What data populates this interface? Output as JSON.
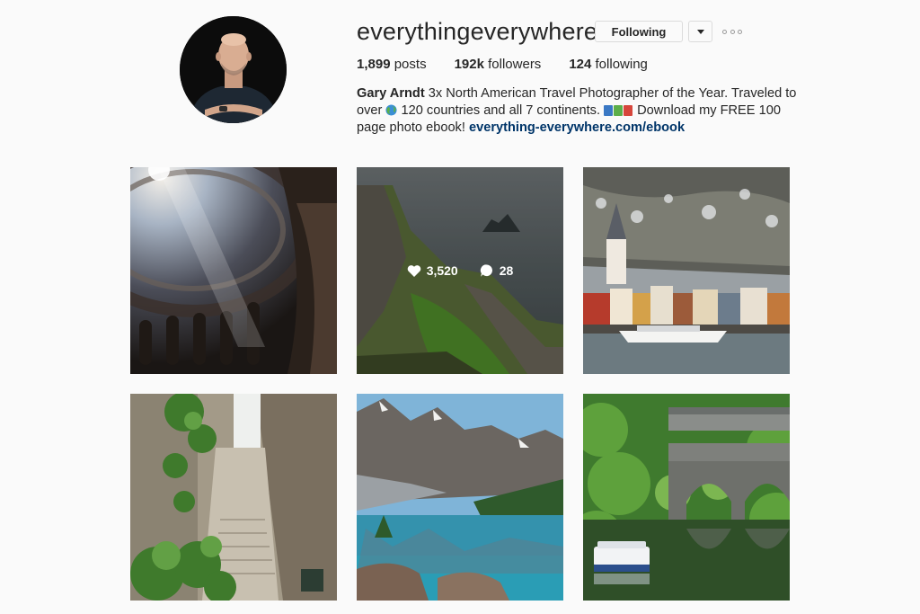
{
  "profile": {
    "username": "everythingeverywhere",
    "follow_label": "Following",
    "avatar_alt": "avatar"
  },
  "stats": {
    "posts_count": "1,899",
    "posts_label": "posts",
    "followers_count": "192k",
    "followers_label": "followers",
    "following_count": "124",
    "following_label": "following"
  },
  "bio": {
    "name": "Gary Arndt",
    "line1_rest": "3x North American Travel Photographer of the Year. Traveled to",
    "line2_a": "over",
    "line2_b": "120 countries and all 7 continents.",
    "line2_c": "Download my FREE 100",
    "line3_a": "page photo ebook!",
    "link": "everything-everywhere.com/ebook"
  },
  "posts": [
    {
      "name": "post-dome-interior"
    },
    {
      "name": "post-coastal-cliffs",
      "likes": "3,520",
      "comments": "28"
    },
    {
      "name": "post-riverside-town"
    },
    {
      "name": "post-stone-alley"
    },
    {
      "name": "post-mountain-lake"
    },
    {
      "name": "post-river-bridge"
    }
  ],
  "colors": {
    "background": "#fafafa",
    "text": "#262626",
    "link": "#003569",
    "border": "#dbdbdb"
  },
  "icons": {
    "dropdown": "chevron-down-icon",
    "more": "more-options-icon",
    "globe": "globe-emoji-icon",
    "books": "books-emoji-icon",
    "heart": "heart-icon",
    "comment": "comment-icon"
  }
}
